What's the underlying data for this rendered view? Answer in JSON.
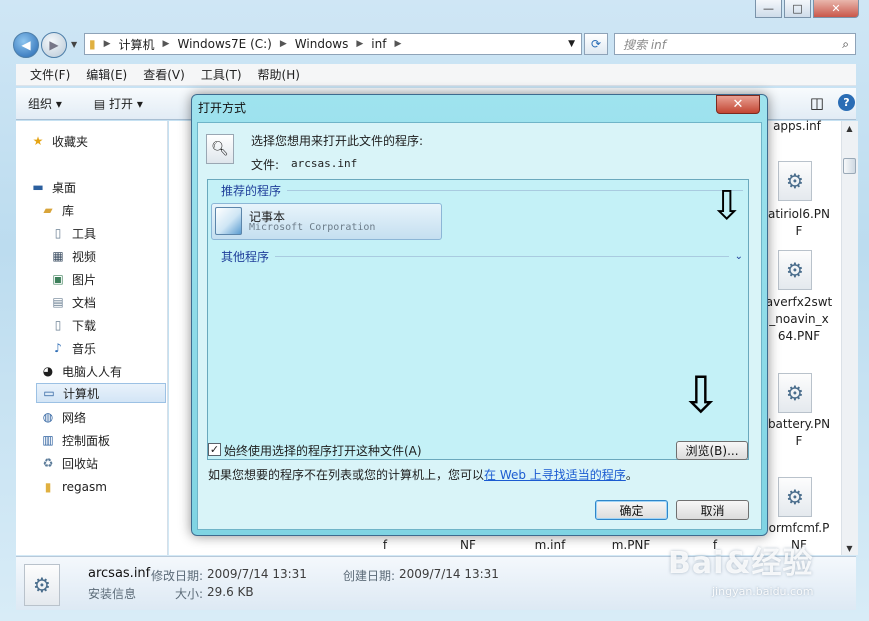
{
  "window": {
    "min_label": "—",
    "max_label": "□",
    "close_label": "✕"
  },
  "address": {
    "crumbs": [
      "计算机",
      "Windows7E (C:)",
      "Windows",
      "inf"
    ],
    "search_placeholder": "搜索 inf"
  },
  "menu": [
    "文件(F)",
    "编辑(E)",
    "查看(V)",
    "工具(T)",
    "帮助(H)"
  ],
  "toolbar": {
    "organize": "组织 ▾",
    "open": "打开 ▾"
  },
  "nav": {
    "favorites": "收藏夹",
    "desktop": "桌面",
    "library": "库",
    "tools": "工具",
    "video": "视频",
    "pictures": "图片",
    "docs": "文档",
    "downloads": "下载",
    "music": "音乐",
    "renren": "电脑人人有",
    "computer": "计算机",
    "network": "网络",
    "control_panel": "控制面板",
    "recycle": "回收站",
    "regasm": "regasm"
  },
  "files": {
    "f1": "apps.inf",
    "f2a": "atiriol6.PN",
    "f2b": "F",
    "f3a": "averfx2swt",
    "f3b": "_noavin_x",
    "f3c": "64.PNF",
    "f4a": "battery.PN",
    "f4b": "F",
    "f5a": "ormfcmf.P",
    "f5b": "NF",
    "bottom": [
      "f",
      "NF",
      "m.inf",
      "m.PNF",
      "f"
    ]
  },
  "details": {
    "name": "arcsas.inf",
    "modified_label": "修改日期:",
    "modified": "2009/7/14 13:31",
    "created_label": "创建日期:",
    "created": "2009/7/14 13:31",
    "type": "安装信息",
    "size_label": "大小:",
    "size": "29.6 KB"
  },
  "dialog": {
    "title": "打开方式",
    "close": "✕",
    "prompt": "选择您想用来打开此文件的程序:",
    "file_label": "文件:",
    "file_name": "arcsas.inf",
    "recommended": "推荐的程序",
    "notepad_name": "记事本",
    "notepad_company": "Microsoft Corporation",
    "other": "其他程序",
    "always_use": "始终使用选择的程序打开这种文件(A)",
    "browse": "浏览(B)...",
    "hint_prefix": "如果您想要的程序不在列表或您的计算机上，您可以",
    "hint_link": "在 Web 上寻找适当的程序",
    "hint_suffix": "。",
    "ok": "确定",
    "cancel": "取消"
  },
  "watermark": {
    "brand": "Bai&经验",
    "url": "jingyan.baidu.com"
  }
}
